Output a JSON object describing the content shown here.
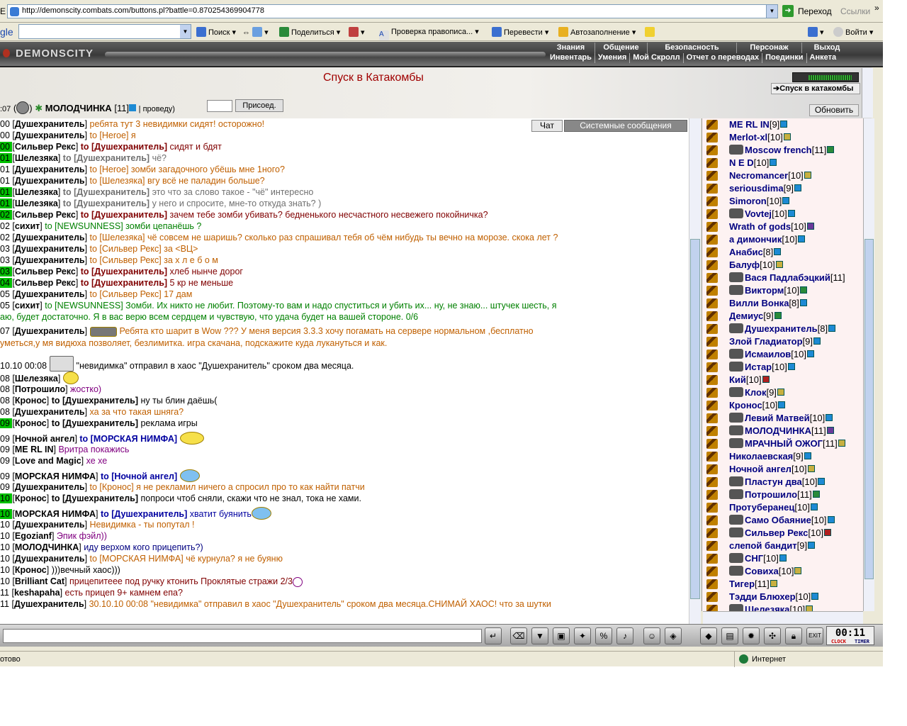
{
  "browser": {
    "address_label": "Е",
    "url": "http://demonscity.combats.com/buttons.pl?battle=0.870254369904778",
    "go_label": "Переход",
    "links_label": "Ссылки",
    "more": "»"
  },
  "gtoolbar": {
    "logo": "gle",
    "search_label": "Поиск",
    "share_label": "Поделиться",
    "spell_label": "Проверка правописа...",
    "translate_label": "Перевести",
    "autofill_label": "Автозаполнение",
    "login_label": "Войти"
  },
  "game": {
    "logo": "DEMONSCITY",
    "menu_top": [
      "Знания",
      "Общение",
      "Безопасность",
      "Персонаж",
      "Выход"
    ],
    "menu_bottom": [
      "Инвентарь",
      "Умения",
      "Мой Скролл",
      "Отчет о переводах",
      "Поединки",
      "Анкета"
    ],
    "location_title": "Спуск в Катакомбы",
    "hp_progress": 0.9,
    "location_button": "Спуск в катакомбы",
    "refresh_button": "Обновить",
    "top_time": ":07",
    "top_nick": "МОЛОДЧИНКА",
    "top_level": "[11]",
    "top_suffix": "| проведу)",
    "join_button": "Присоед."
  },
  "tabs": {
    "chat": "Чат",
    "system": "Системные сообщения"
  },
  "chat": [
    {
      "t": "00",
      "hl": false,
      "who": "Душехранитель",
      "to": "",
      "msg": "ребята тут 3 невидимки сидят! осторожно!",
      "c": "c-o"
    },
    {
      "t": "00",
      "hl": false,
      "who": "Душехранитель",
      "to": "to [Heroe]",
      "msg": "я",
      "c": "c-o"
    },
    {
      "t": "00",
      "hl": true,
      "who": "Сильвер Рекс",
      "to": "to [Душехранитель]",
      "msg": "сидят и бдят",
      "c": "c-r"
    },
    {
      "t": "01",
      "hl": true,
      "who": "Шелезяка",
      "to": "to [Душехранитель]",
      "msg": "чё?",
      "c": "c-gr"
    },
    {
      "t": "01",
      "hl": false,
      "who": "Душехранитель",
      "to": "to [Heroe]",
      "msg": "зомби загадочного убёшь мне 1ного?",
      "c": "c-o"
    },
    {
      "t": "01",
      "hl": false,
      "who": "Душехранитель",
      "to": "to [Шелезяка]",
      "msg": "вгу всё не паладин больше?",
      "c": "c-o"
    },
    {
      "t": "01",
      "hl": true,
      "who": "Шелезяка",
      "to": "to [Душехранитель]",
      "msg": "это что за слово такое - \"чё\" интересно",
      "c": "c-gr"
    },
    {
      "t": "01",
      "hl": true,
      "who": "Шелезяка",
      "to": "to [Душехранитель]",
      "msg": "у него и спросите, мне-то откуда знать? )",
      "c": "c-gr"
    },
    {
      "t": "02",
      "hl": true,
      "who": "Сильвер Рекс",
      "to": "to [Душехранитель]",
      "msg": "зачем тебе зомби убивать? бедненького несчастного несвежего покойничка?",
      "c": "c-r"
    },
    {
      "t": "02",
      "hl": false,
      "who": "сихит",
      "to": "to [NEWSUNNESS]",
      "msg": "зомби цепанёшь ?",
      "c": "c-g"
    },
    {
      "t": "02",
      "hl": false,
      "who": "Душехранитель",
      "to": "to [Шелезяка]",
      "msg": "чё совсем не шаришь? сколько раз спрашивал тебя об чём нибудь ты вечно на морозе. скока лет ?",
      "c": "c-o"
    },
    {
      "t": "03",
      "hl": false,
      "who": "Душехранитель",
      "to": "to [Сильвер Рекс]",
      "msg": "за <ВЦ>",
      "c": "c-o"
    },
    {
      "t": "03",
      "hl": false,
      "who": "Душехранитель",
      "to": "to [Сильвер Рекс]",
      "msg": "за х л е б о м",
      "c": "c-o"
    },
    {
      "t": "03",
      "hl": true,
      "who": "Сильвер Рекс",
      "to": "to [Душехранитель]",
      "msg": "хлеб нынче дорог",
      "c": "c-r"
    },
    {
      "t": "04",
      "hl": true,
      "who": "Сильвер Рекс",
      "to": "to [Душехранитель]",
      "msg": "5 кр не меньше",
      "c": "c-r"
    },
    {
      "t": "05",
      "hl": false,
      "who": "Душехранитель",
      "to": "to [Сильвер Рекс]",
      "msg": "17 дам",
      "c": "c-o"
    },
    {
      "t": "05",
      "hl": false,
      "who": "сихит",
      "to": "to [NEWSUNNESS]",
      "msg": "Зомби. Их никто не любит. Поэтому-то вам и надо спуститься и убить их... ну, не знаю... штучек шесть, я",
      "c": "c-g"
    },
    {
      "t": "",
      "hl": false,
      "who": "",
      "to": "",
      "msg": "аю, будет достаточно. Я в вас верю всем сердцем и чувствую, что удача будет на вашей стороне. 0/6",
      "c": "c-g"
    },
    {
      "t": "07",
      "hl": false,
      "who": "Душехранитель",
      "to": "",
      "msg": "Ребята кто шарит в Wow ??? У меня версия 3.3.3 хочу погамать на сервере нормальном ,бесплатно",
      "c": "c-o"
    },
    {
      "t": "",
      "hl": false,
      "who": "",
      "to": "",
      "msg": "уметься,у мя видюха позволяет, безлимитка. игра скачана, подскажите куда лукануться и как.",
      "c": "c-o"
    },
    {
      "t": "10.10 00:08",
      "hl": false,
      "who": "",
      "to": "",
      "msg": "\"невидимка\" отправил в хаос \"Душехранитель\" сроком два месяца.",
      "c": "t"
    },
    {
      "t": "08",
      "hl": false,
      "who": "Шелезяка",
      "to": "",
      "msg": "",
      "c": "c-gr"
    },
    {
      "t": "08",
      "hl": false,
      "who": "Потрошило",
      "to": "",
      "msg": "жостко)",
      "c": "c-p"
    },
    {
      "t": "08",
      "hl": false,
      "who": "Кронос",
      "to": "to [Душехранитель]",
      "msg": "ну ты блин даёшь(",
      "c": "t"
    },
    {
      "t": "08",
      "hl": false,
      "who": "Душехранитель",
      "to": "",
      "msg": "ха за что такая шняга?",
      "c": "c-o"
    },
    {
      "t": "09",
      "hl": true,
      "who": "Кронос",
      "to": "to [Душехранитель]",
      "msg": "реклама игры",
      "c": "t"
    },
    {
      "t": "09",
      "hl": false,
      "who": "Ночной ангел",
      "to": "to [МОРСКАЯ НИМФА]",
      "msg": "",
      "c": "c-b"
    },
    {
      "t": "09",
      "hl": false,
      "who": "ME RL IN",
      "to": "",
      "msg": "Вритра покажись",
      "c": "c-p"
    },
    {
      "t": "09",
      "hl": false,
      "who": "Love and Magic",
      "to": "",
      "msg": "хе хе",
      "c": "c-p"
    },
    {
      "t": "09",
      "hl": false,
      "who": "МОРСКАЯ НИМФА",
      "to": "to [Ночной ангел]",
      "msg": "",
      "c": "c-b"
    },
    {
      "t": "09",
      "hl": false,
      "who": "Душехранитель",
      "to": "to [Кронос]",
      "msg": "я не рекламил ничего а спросил про то как найти патчи",
      "c": "c-o"
    },
    {
      "t": "10",
      "hl": true,
      "who": "Кронос",
      "to": "to [Душехранитель]",
      "msg": "попроси чтоб сняли, скажи что не знал, тока не хами.",
      "c": "t"
    },
    {
      "t": "10",
      "hl": true,
      "who": "МОРСКАЯ НИМФА",
      "to": "to [Душехранитель]",
      "msg": "хватит буянить",
      "c": "c-b"
    },
    {
      "t": "10",
      "hl": false,
      "who": "Душехранитель",
      "to": "",
      "msg": "Невидимка - ты попутал !",
      "c": "c-o"
    },
    {
      "t": "10",
      "hl": false,
      "who": "Egozianf",
      "to": "",
      "msg": "Эпик фэйл))",
      "c": "c-p"
    },
    {
      "t": "10",
      "hl": false,
      "who": "МОЛОДЧИНКА",
      "to": "",
      "msg": "иду верхом кого прицепить?)",
      "c": "c-bl"
    },
    {
      "t": "10",
      "hl": false,
      "who": "Душехранитель",
      "to": "to [МОРСКАЯ НИМФА]",
      "msg": "чё курнула? я не буяню",
      "c": "c-o"
    },
    {
      "t": "10",
      "hl": false,
      "who": "Кронос",
      "to": "",
      "msg": ")))вечный хаос)))",
      "c": "t"
    },
    {
      "t": "10",
      "hl": false,
      "who": "Brilliant Cat",
      "to": "",
      "msg": "прицепитеее под ручку ктонить Проклятые стражи 2/3",
      "c": "c-r"
    },
    {
      "t": "11",
      "hl": false,
      "who": "keshapaha",
      "to": "",
      "msg": "есть прицеп 9+ камнем епа?",
      "c": "c-r"
    },
    {
      "t": "11",
      "hl": false,
      "who": "Душехранитель",
      "to": "",
      "msg": "30.10.10 00:08 \"невидимка\" отправил в хаос \"Душехранитель\" сроком два месяца.СНИМАЙ ХАОС! что за шутки",
      "c": "c-o"
    }
  ],
  "users": [
    {
      "name": "ME RL IN",
      "lvl": "[9]",
      "av": false,
      "inf": "b"
    },
    {
      "name": "Merlot-xl",
      "lvl": "[10]",
      "av": false,
      "inf": "yl"
    },
    {
      "name": "Moscow french",
      "lvl": "[11]",
      "av": true,
      "inf": "gr"
    },
    {
      "name": "N E D",
      "lvl": "[10]",
      "av": false,
      "inf": "b"
    },
    {
      "name": "Necromancer",
      "lvl": "[10]",
      "av": false,
      "inf": "yl"
    },
    {
      "name": "seriousdima",
      "lvl": "[9]",
      "av": false,
      "inf": "b"
    },
    {
      "name": "Simoron",
      "lvl": "[10]",
      "av": false,
      "inf": "b"
    },
    {
      "name": "Vovtej",
      "lvl": "[10]",
      "av": true,
      "inf": "b"
    },
    {
      "name": "Wrath of gods",
      "lvl": "[10]",
      "av": false,
      "inf": "pu"
    },
    {
      "name": "а димончик",
      "lvl": "[10]",
      "av": false,
      "inf": "b"
    },
    {
      "name": "Анабис",
      "lvl": "[8]",
      "av": false,
      "inf": "b"
    },
    {
      "name": "Балуф",
      "lvl": "[10]",
      "av": false,
      "inf": "yl"
    },
    {
      "name": "Вася Падлабэцкий",
      "lvl": "[11]",
      "av": true,
      "inf": ""
    },
    {
      "name": "Викторм",
      "lvl": "[10]",
      "av": true,
      "inf": "gr"
    },
    {
      "name": "Вилли Вонка",
      "lvl": "[8]",
      "av": false,
      "inf": "b"
    },
    {
      "name": "Демиус",
      "lvl": "[9]",
      "av": false,
      "inf": "gr"
    },
    {
      "name": "Душехранитель",
      "lvl": "[8]",
      "av": true,
      "inf": "b"
    },
    {
      "name": "Злой Гладиатор",
      "lvl": "[9]",
      "av": false,
      "inf": "b"
    },
    {
      "name": "Исмаилов",
      "lvl": "[10]",
      "av": true,
      "inf": "b"
    },
    {
      "name": "Истар",
      "lvl": "[10]",
      "av": true,
      "inf": "b"
    },
    {
      "name": "Кий",
      "lvl": "[10]",
      "av": false,
      "inf": "rd"
    },
    {
      "name": "Клок",
      "lvl": "[9]",
      "av": true,
      "inf": "yl"
    },
    {
      "name": "Кронос",
      "lvl": "[10]",
      "av": false,
      "inf": "b"
    },
    {
      "name": "Левий Матвей",
      "lvl": "[10]",
      "av": true,
      "inf": "b"
    },
    {
      "name": "МОЛОДЧИНКА",
      "lvl": "[11]",
      "av": true,
      "inf": "pu"
    },
    {
      "name": "МРАЧНЫЙ ОЖОГ",
      "lvl": "[11]",
      "av": true,
      "inf": "yl"
    },
    {
      "name": "Николаевская",
      "lvl": "[9]",
      "av": false,
      "inf": "b"
    },
    {
      "name": "Ночной ангел",
      "lvl": "[10]",
      "av": false,
      "inf": "yl"
    },
    {
      "name": "Пластун два",
      "lvl": "[10]",
      "av": true,
      "inf": "b"
    },
    {
      "name": "Потрошило",
      "lvl": "[11]",
      "av": true,
      "inf": "gr"
    },
    {
      "name": "Протуберанец",
      "lvl": "[10]",
      "av": false,
      "inf": "b"
    },
    {
      "name": "Само Обаяние",
      "lvl": "[10]",
      "av": true,
      "inf": "b"
    },
    {
      "name": "Сильвер Рекс",
      "lvl": "[10]",
      "av": true,
      "inf": "rd"
    },
    {
      "name": "слепой бандит",
      "lvl": "[9]",
      "av": false,
      "inf": "b"
    },
    {
      "name": "СНГ",
      "lvl": "[10]",
      "av": true,
      "inf": "b"
    },
    {
      "name": "Совиха",
      "lvl": "[10]",
      "av": true,
      "inf": "yl"
    },
    {
      "name": "Тигер",
      "lvl": "[11]",
      "av": false,
      "inf": "yl"
    },
    {
      "name": "Тэдди Блюхер",
      "lvl": "[10]",
      "av": false,
      "inf": "b"
    },
    {
      "name": "Шелезяка",
      "lvl": "[10]",
      "av": true,
      "inf": "yl"
    }
  ],
  "clock": {
    "time": "00:11",
    "lbl_clock": "CLOCK",
    "lbl_timer": "TIMER",
    "exit": "EXIT"
  },
  "status": {
    "left": "отово",
    "zone": "Интернет"
  }
}
